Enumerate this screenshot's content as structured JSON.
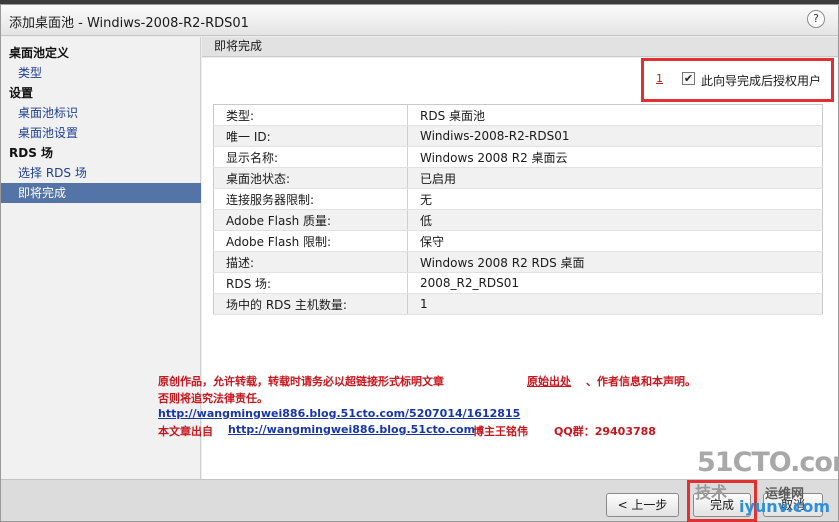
{
  "window": {
    "title": "添加桌面池 - Windiws-2008-R2-RDS01",
    "help_icon": "?"
  },
  "nav": {
    "items": [
      {
        "label": "桌面池定义",
        "type": "section"
      },
      {
        "label": "类型",
        "type": "item"
      },
      {
        "label": "设置",
        "type": "section"
      },
      {
        "label": "桌面池标识",
        "type": "item"
      },
      {
        "label": "桌面池设置",
        "type": "item"
      },
      {
        "label": "RDS 场",
        "type": "section"
      },
      {
        "label": "选择 RDS 场",
        "type": "item"
      },
      {
        "label": "即将完成",
        "type": "item",
        "active": true
      }
    ]
  },
  "main": {
    "header": "即将完成",
    "authorize": {
      "annotation": "1",
      "checked_glyph": "✔",
      "label": "此向导完成后授权用户"
    },
    "summary": [
      {
        "key": "类型:",
        "value": "RDS 桌面池"
      },
      {
        "key": "唯一 ID:",
        "value": "Windiws-2008-R2-RDS01"
      },
      {
        "key": "显示名称:",
        "value": "Windows 2008 R2 桌面云"
      },
      {
        "key": "桌面池状态:",
        "value": "已启用"
      },
      {
        "key": "连接服务器限制:",
        "value": "无"
      },
      {
        "key": "Adobe Flash 质量:",
        "value": "低"
      },
      {
        "key": "Adobe Flash 限制:",
        "value": "保守"
      },
      {
        "key": "描述:",
        "value": "Windows 2008 R2 RDS 桌面"
      },
      {
        "key": "RDS 场:",
        "value": "2008_R2_RDS01"
      },
      {
        "key": "场中的 RDS 主机数量:",
        "value": "1"
      }
    ]
  },
  "notice": {
    "line1a": "原创作品，允许转载，转载时请务必以超链接形式标明文章",
    "line1_link": "原始出处",
    "line1b": "、作者信息和本声明。",
    "line2": "否则将追究法律责任。",
    "url1": "http://wangmingwei886.blog.51cto.com/5207014/1612815",
    "line4_prefix": "本文章出自",
    "url2": "http://wangmingwei886.blog.51cto.com",
    "author": "博主王铭伟",
    "qq": "QQ群：29403788"
  },
  "footer": {
    "back": "< 上一步",
    "finish": "完成",
    "cancel": "取消"
  },
  "watermark": {
    "site": "51CTO.com",
    "tag1": "技术",
    "tag2": "运维网",
    "url": "iyunv.com"
  }
}
